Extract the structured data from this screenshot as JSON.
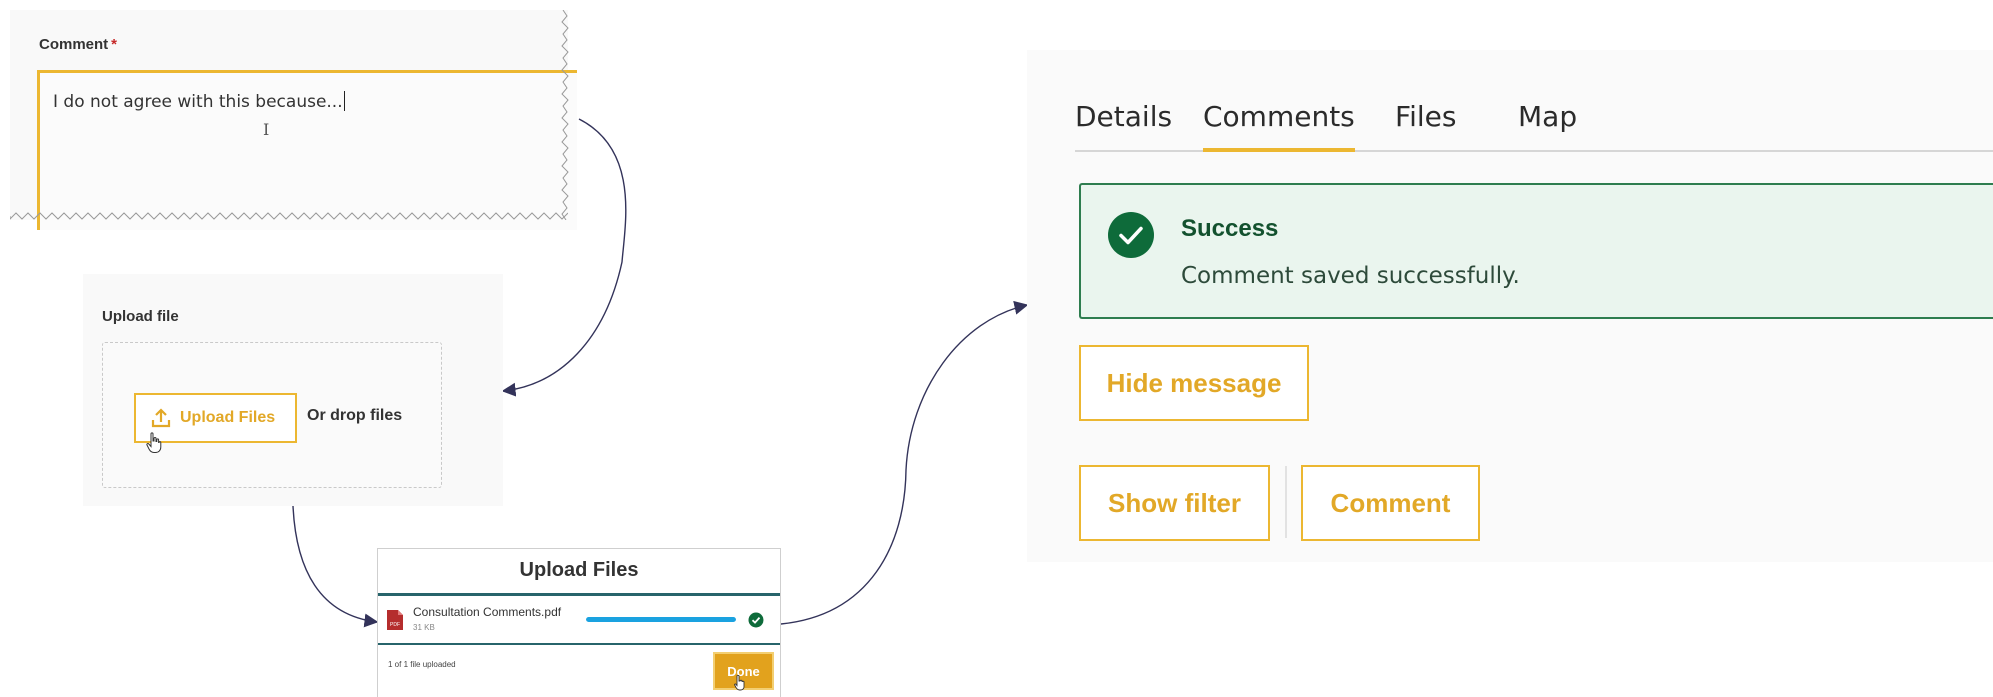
{
  "comment_panel": {
    "label": "Comment",
    "required_marker": "*",
    "value": "I do not agree with this because..."
  },
  "upload_panel": {
    "label": "Upload file",
    "upload_button_label": "Upload Files",
    "drop_text": "Or drop files",
    "upload_icon": "upload-icon"
  },
  "upload_dialog": {
    "title": "Upload Files",
    "file": {
      "name": "Consultation Comments.pdf",
      "size": "31 KB",
      "type_icon": "pdf-icon",
      "type_label": "PDF",
      "progress": 1.0
    },
    "status_text": "1 of 1 file uploaded",
    "done_label": "Done"
  },
  "detail_panel": {
    "tabs": [
      {
        "label": "Details",
        "active": false
      },
      {
        "label": "Comments",
        "active": true
      },
      {
        "label": "Files",
        "active": false
      },
      {
        "label": "Map",
        "active": false
      }
    ],
    "alert": {
      "heading": "Success",
      "message": "Comment saved successfully.",
      "icon": "check-circle-icon"
    },
    "buttons": {
      "hide_message": "Hide message",
      "show_filter": "Show filter",
      "comment": "Comment"
    }
  },
  "colors": {
    "accent": "#ecb731",
    "accent_text": "#e2a827",
    "success_border": "#2e7d4f",
    "success_bg": "#eaf5ee",
    "success_icon": "#0e6b3a",
    "progress": "#1aa2e0",
    "arrow": "#33335a"
  }
}
